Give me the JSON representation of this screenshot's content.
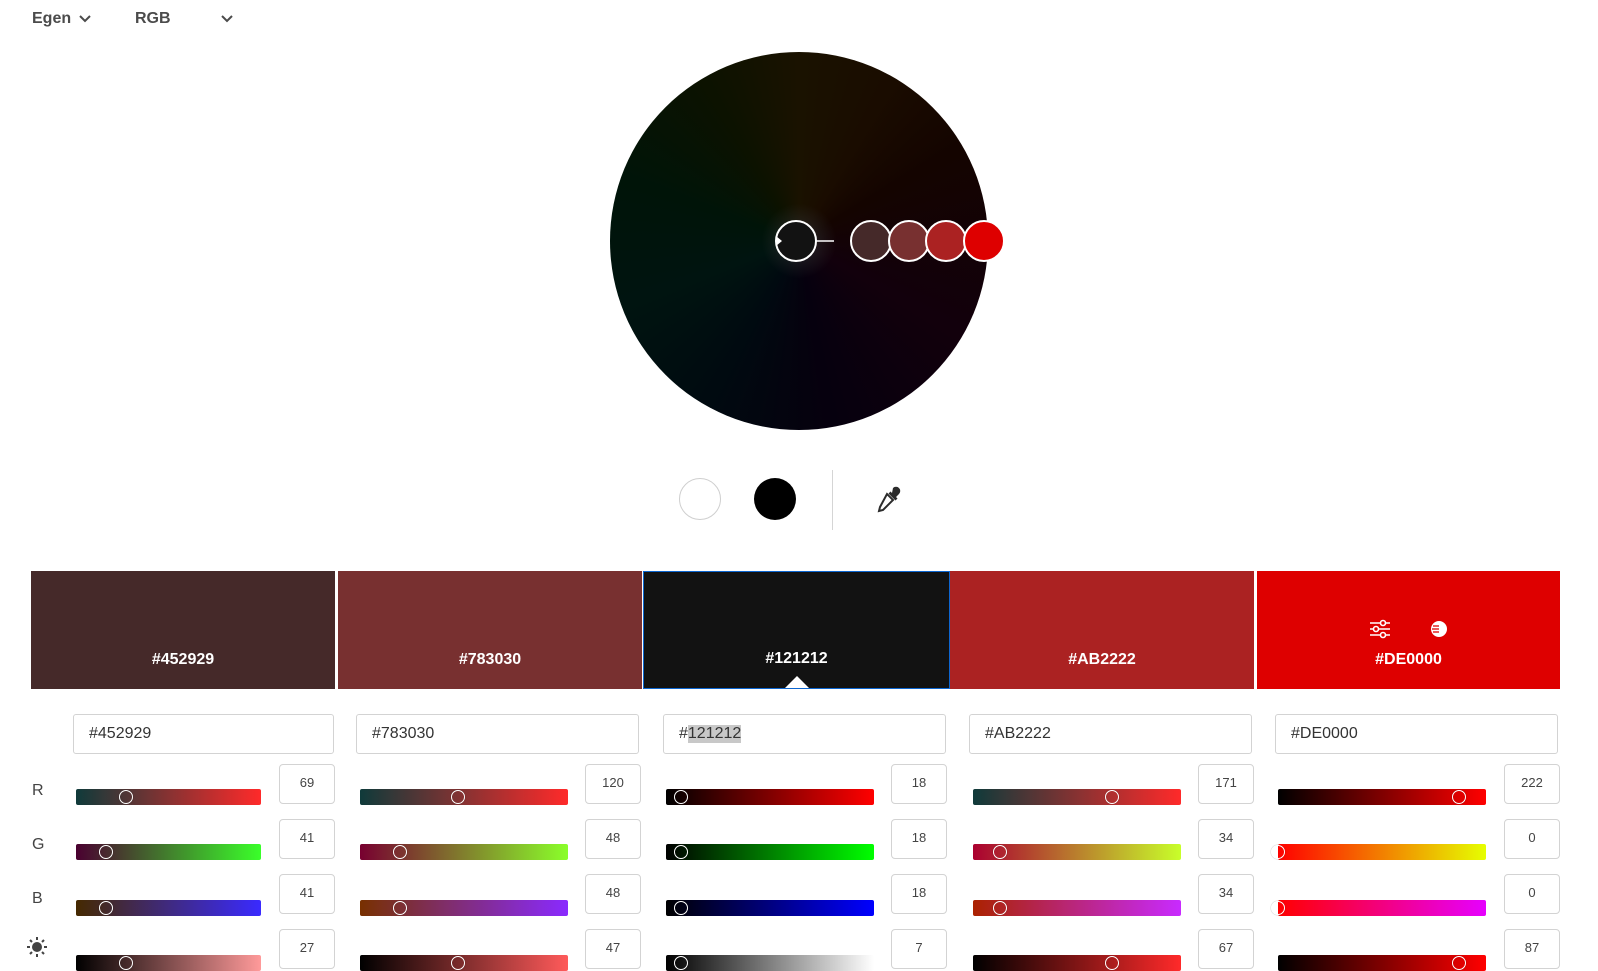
{
  "toolbar": {
    "rule_label": "Egen",
    "mode_label": "RGB"
  },
  "wheel": {
    "markers": [
      {
        "color": "#121212",
        "base": true
      },
      {
        "color": "#452929"
      },
      {
        "color": "#783030"
      },
      {
        "color": "#AB2222"
      },
      {
        "color": "#DE0000"
      }
    ]
  },
  "quick": {
    "white_icon": "white-circle-icon",
    "black_icon": "black-circle-icon",
    "picker_icon": "eyedropper-icon"
  },
  "swatches": [
    {
      "hex": "#452929",
      "color": "#452929"
    },
    {
      "hex": "#783030",
      "color": "#783030"
    },
    {
      "hex": "#121212",
      "color": "#121212",
      "active": true
    },
    {
      "hex": "#AB2222",
      "color": "#AB2222"
    },
    {
      "hex": "#DE0000",
      "color": "#DE0000",
      "tools": [
        "sliders-icon",
        "contrast-icon"
      ]
    }
  ],
  "inputs": [
    {
      "value": "#452929"
    },
    {
      "value": "#783030"
    },
    {
      "prefix": "#",
      "selected": "121212"
    },
    {
      "value": "#AB2222"
    },
    {
      "value": "#DE0000"
    }
  ],
  "channel_labels": {
    "r": "R",
    "g": "G",
    "b": "B",
    "brightness_icon": "brightness-icon"
  },
  "columns": [
    {
      "r": "69",
      "g": "41",
      "b": "41",
      "br": "27",
      "r_frac": 0.27,
      "g_frac": 0.16,
      "b_frac": 0.16,
      "br_frac": 0.27,
      "r_grad": [
        "#0f3a3a",
        "#ff2a2a"
      ],
      "g_grad": [
        "#4a0030",
        "#3aff2a"
      ],
      "b_grad": [
        "#452900",
        "#3a2aff"
      ],
      "br_grad": [
        "#000000",
        "#ff9a9a"
      ]
    },
    {
      "r": "120",
      "g": "48",
      "b": "48",
      "br": "47",
      "r_frac": 0.47,
      "g_frac": 0.19,
      "b_frac": 0.19,
      "br_frac": 0.47,
      "r_grad": [
        "#0f3a3a",
        "#ff2a2a"
      ],
      "g_grad": [
        "#780030",
        "#8aff2a"
      ],
      "b_grad": [
        "#783000",
        "#8a2aff"
      ],
      "br_grad": [
        "#000000",
        "#ff5a5a"
      ]
    },
    {
      "r": "18",
      "g": "18",
      "b": "18",
      "br": "7",
      "r_frac": 0.07,
      "g_frac": 0.07,
      "b_frac": 0.07,
      "br_frac": 0.07,
      "r_grad": [
        "#000000",
        "#ff0000"
      ],
      "g_grad": [
        "#000000",
        "#00ff00"
      ],
      "b_grad": [
        "#000000",
        "#0000ff"
      ],
      "br_grad": [
        "#000000",
        "#ffffff"
      ]
    },
    {
      "r": "171",
      "g": "34",
      "b": "34",
      "br": "67",
      "r_frac": 0.67,
      "g_frac": 0.13,
      "b_frac": 0.13,
      "br_frac": 0.67,
      "r_grad": [
        "#0f3a3a",
        "#ff2a2a"
      ],
      "g_grad": [
        "#ab0030",
        "#c8ff2a"
      ],
      "b_grad": [
        "#ab2200",
        "#c82aff"
      ],
      "br_grad": [
        "#000000",
        "#ff2a2a"
      ]
    },
    {
      "r": "222",
      "g": "0",
      "b": "0",
      "br": "87",
      "r_frac": 0.87,
      "g_frac": 0.0,
      "b_frac": 0.0,
      "br_frac": 0.87,
      "r_grad": [
        "#000000",
        "#ff0000"
      ],
      "g_grad": [
        "#ff0000",
        "#e6ff00"
      ],
      "b_grad": [
        "#ff0000",
        "#e600ff"
      ],
      "br_grad": [
        "#000000",
        "#ff0000"
      ]
    }
  ]
}
